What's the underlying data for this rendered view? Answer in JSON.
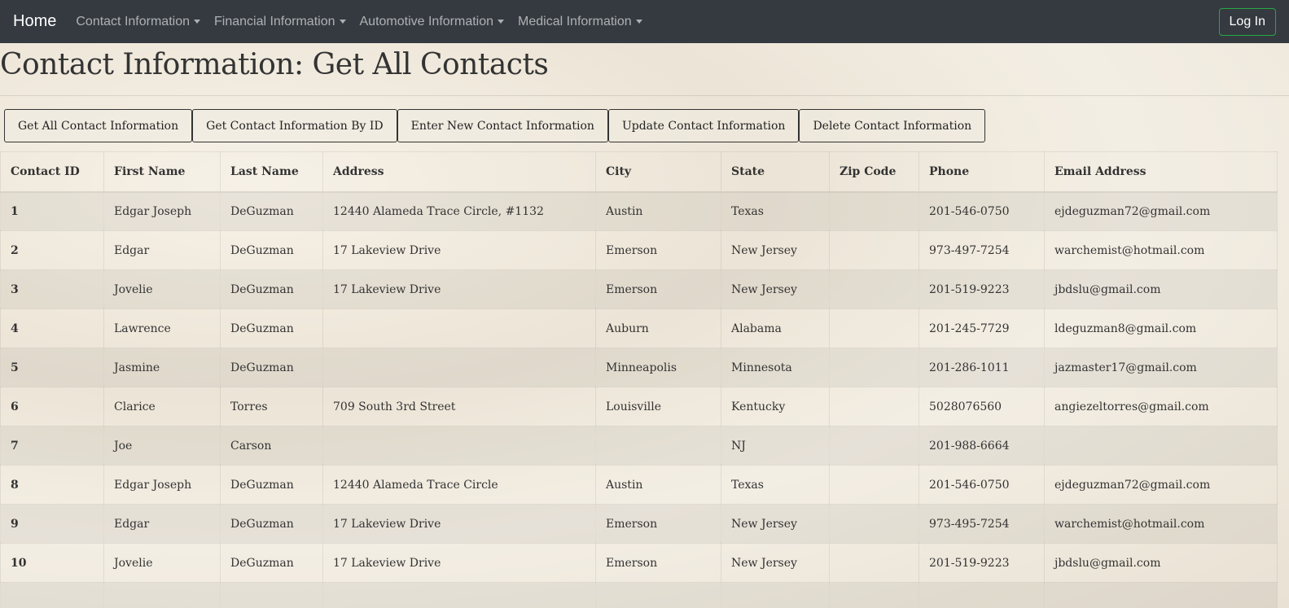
{
  "navbar": {
    "brand": "Home",
    "menus": [
      {
        "label": "Contact Information"
      },
      {
        "label": "Financial Information"
      },
      {
        "label": "Automotive Information"
      },
      {
        "label": "Medical Information"
      }
    ],
    "login_label": "Log In"
  },
  "page": {
    "title": "Contact Information: Get All Contacts"
  },
  "actions": {
    "get_all": "Get All Contact Information",
    "get_by_id": "Get Contact Information By ID",
    "enter_new": "Enter New Contact Information",
    "update": "Update Contact Information",
    "delete": "Delete Contact Information"
  },
  "table": {
    "headers": [
      "Contact ID",
      "First Name",
      "Last Name",
      "Address",
      "City",
      "State",
      "Zip Code",
      "Phone",
      "Email Address"
    ],
    "rows": [
      [
        "1",
        "Edgar Joseph",
        "DeGuzman",
        "12440 Alameda Trace Circle, #1132",
        "Austin",
        "Texas",
        "",
        "201-546-0750",
        "ejdeguzman72@gmail.com"
      ],
      [
        "2",
        "Edgar",
        "DeGuzman",
        "17 Lakeview Drive",
        "Emerson",
        "New Jersey",
        "",
        "973-497-7254",
        "warchemist@hotmail.com"
      ],
      [
        "3",
        "Jovelie",
        "DeGuzman",
        "17 Lakeview Drive",
        "Emerson",
        "New Jersey",
        "",
        "201-519-9223",
        "jbdslu@gmail.com"
      ],
      [
        "4",
        "Lawrence",
        "DeGuzman",
        "",
        "Auburn",
        "Alabama",
        "",
        "201-245-7729",
        "ldeguzman8@gmail.com"
      ],
      [
        "5",
        "Jasmine",
        "DeGuzman",
        "",
        "Minneapolis",
        "Minnesota",
        "",
        "201-286-1011",
        "jazmaster17@gmail.com"
      ],
      [
        "6",
        "Clarice",
        "Torres",
        "709 South 3rd Street",
        "Louisville",
        "Kentucky",
        "",
        "5028076560",
        "angiezeltorres@gmail.com"
      ],
      [
        "7",
        "Joe",
        "Carson",
        "",
        "",
        "NJ",
        "",
        "201-988-6664",
        ""
      ],
      [
        "8",
        "Edgar Joseph",
        "DeGuzman",
        "12440 Alameda Trace Circle",
        "Austin",
        "Texas",
        "",
        "201-546-0750",
        "ejdeguzman72@gmail.com"
      ],
      [
        "9",
        "Edgar",
        "DeGuzman",
        "17 Lakeview Drive",
        "Emerson",
        "New Jersey",
        "",
        "973-495-7254",
        "warchemist@hotmail.com"
      ],
      [
        "10",
        "Jovelie",
        "DeGuzman",
        "17 Lakeview Drive",
        "Emerson",
        "New Jersey",
        "",
        "201-519-9223",
        "jbdslu@gmail.com"
      ],
      [
        "",
        "",
        "",
        "",
        "",
        "",
        "",
        "",
        ""
      ]
    ]
  }
}
